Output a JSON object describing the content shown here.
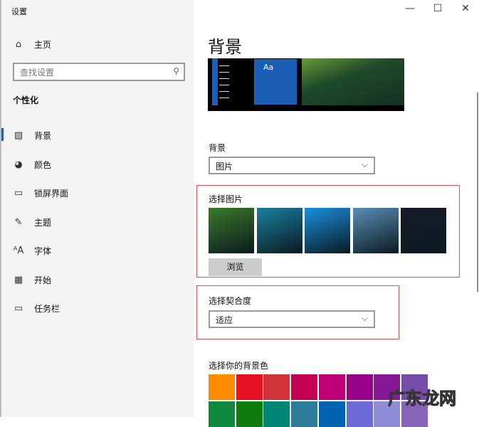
{
  "window": {
    "title": "设置",
    "minimize": "—",
    "maximize": "☐",
    "close": "✕"
  },
  "sidebar": {
    "home": "主页",
    "search_placeholder": "查找设置",
    "section": "个性化",
    "items": [
      {
        "label": "背景",
        "icon": "picture-icon"
      },
      {
        "label": "颜色",
        "icon": "palette-icon"
      },
      {
        "label": "锁屏界面",
        "icon": "lock-screen-icon"
      },
      {
        "label": "主题",
        "icon": "theme-icon"
      },
      {
        "label": "字体",
        "icon": "font-icon"
      },
      {
        "label": "开始",
        "icon": "start-icon"
      },
      {
        "label": "任务栏",
        "icon": "taskbar-icon"
      }
    ]
  },
  "main": {
    "title": "背景",
    "preview_tile": "Aa",
    "background_label": "背景",
    "background_value": "图片",
    "choose_picture_label": "选择图片",
    "browse": "浏览",
    "fit_label": "选择契合度",
    "fit_value": "适应",
    "bgcolor_label": "选择你的背景色",
    "thumbs": [
      "#3b7a2a",
      "#1b7fa0",
      "#1a8fe0",
      "#5a8fb8",
      "#1a1a2a"
    ],
    "colors": [
      "#ff8c00",
      "#e81123",
      "#d13438",
      "#c30052",
      "#bf0077",
      "#9a0089",
      "#881798",
      "#744da9",
      "#10893e",
      "#107c10",
      "#018574",
      "#2d7d9a",
      "#0063b1",
      "#6b69d6",
      "#8e8cd8",
      "#8764b8"
    ]
  },
  "watermark": "广东龙网"
}
